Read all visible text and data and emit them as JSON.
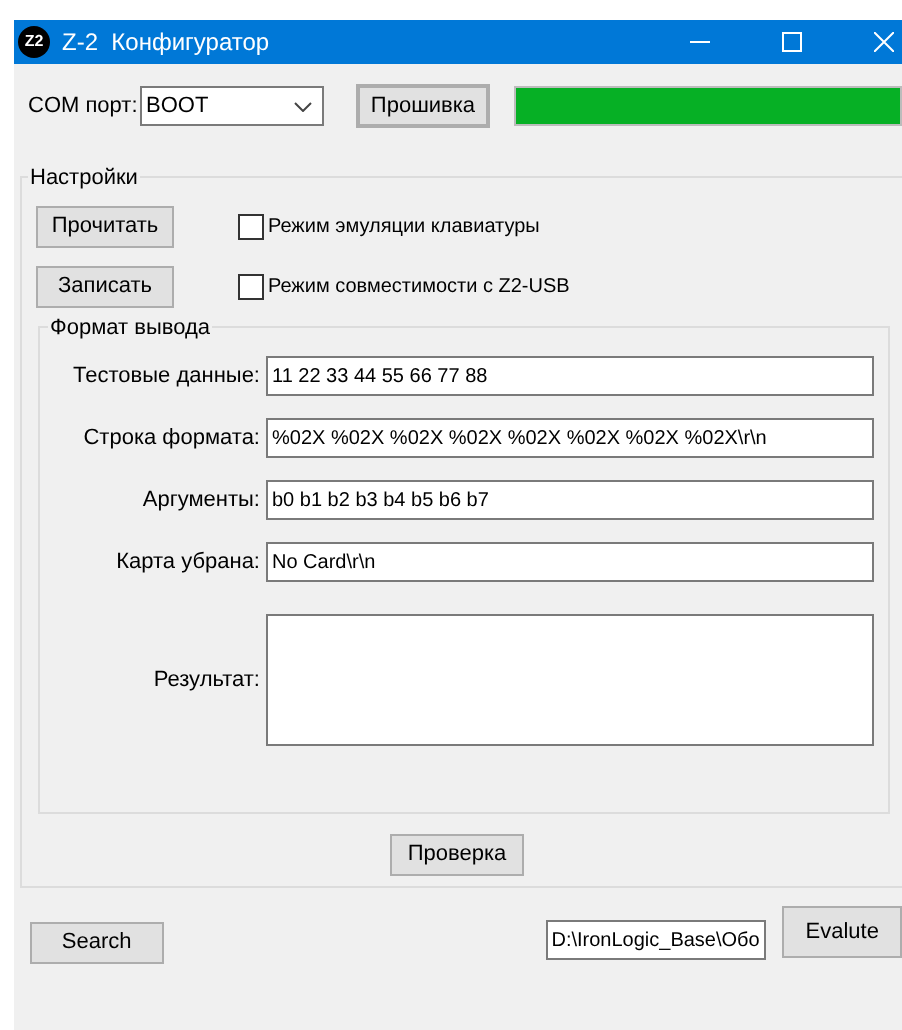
{
  "window": {
    "title": "Z-2  Конфигуратор",
    "icon_text": "Z2"
  },
  "com": {
    "label": "COM порт:",
    "value": "BOOT",
    "flash_button": "Прошивка",
    "progress": {
      "level": 1
    }
  },
  "settings": {
    "title": "Настройки",
    "rows": [
      {
        "button": "Прочитать",
        "checkbox": {
          "label": "Режим эмуляции клавиатуры",
          "checked": false
        }
      },
      {
        "button": "Записать",
        "checkbox": {
          "label": "Режим совместимости с Z2-USB",
          "checked": false
        }
      }
    ],
    "output_format": {
      "title": "Формат вывода",
      "fields": [
        {
          "kind": "line",
          "label": "Тестовые данные:",
          "value": "11 22 33 44 55 66 77 88"
        },
        {
          "kind": "line",
          "label": "Строка формата:",
          "value": "%02X %02X %02X %02X %02X %02X %02X %02X\\r\\n"
        },
        {
          "kind": "line",
          "label": "Аргументы:",
          "value": "b0 b1 b2 b3 b4 b5 b6 b7"
        },
        {
          "kind": "line",
          "label": "Карта убрана:",
          "value": "No Card\\r\\n"
        },
        {
          "kind": "area",
          "label": "Результат:"
        }
      ]
    },
    "check_button": "Проверка"
  },
  "bottom": {
    "search_button": "Search",
    "path_value": "D:\\IronLogic_Base\\Обо",
    "evaluate_button": "Evalute"
  }
}
